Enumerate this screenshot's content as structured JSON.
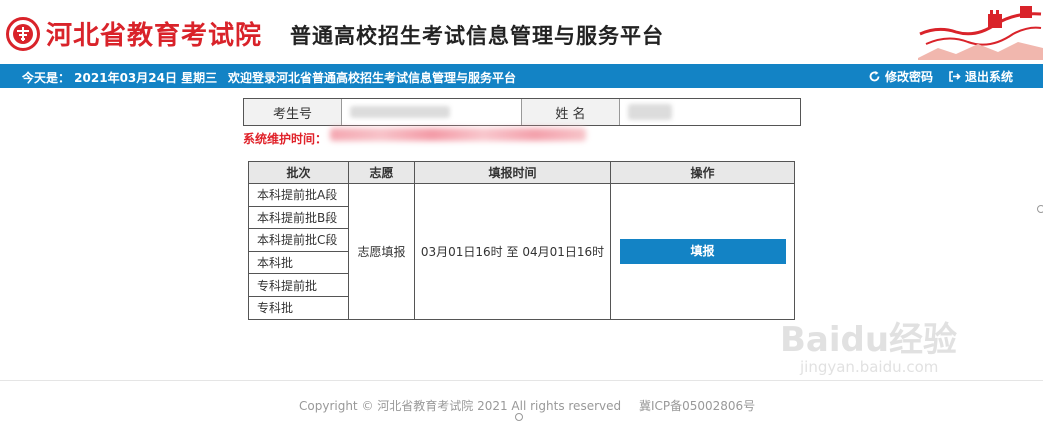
{
  "header": {
    "org_name": "河北省教育考试院",
    "platform_name": "普通高校招生考试信息管理与服务平台",
    "brand_color": "#d9232a",
    "logo_icon": "exam-authority-emblem-icon",
    "decoration_icon": "great-wall-icon"
  },
  "navbar": {
    "date_text": "今天是：  2021年03月24日 星期三",
    "welcome_text": "欢迎登录河北省普通高校招生考试信息管理与服务平台",
    "change_password": "修改密码",
    "logout": "退出系统",
    "accent_color": "#1383c5"
  },
  "student_info": {
    "id_label": "考生号",
    "name_label": "姓 名"
  },
  "maintenance_label": "系统维护时间：",
  "batch_table": {
    "headers": [
      "批次",
      "志愿",
      "填报时间",
      "操作"
    ],
    "batches": [
      "本科提前批A段",
      "本科提前批B段",
      "本科提前批C段",
      "本科批",
      "专科提前批",
      "专科批"
    ],
    "volunteer": "志愿填报",
    "period": "03月01日16时 至 04月01日16时",
    "action_label": "填报"
  },
  "footer": {
    "copyright": "Copyright © 河北省教育考试院 2021 All rights reserved",
    "icp": "冀ICP备05002806号"
  },
  "watermark": {
    "brand": "Baidu经验",
    "url": "jingyan.baidu.com"
  }
}
